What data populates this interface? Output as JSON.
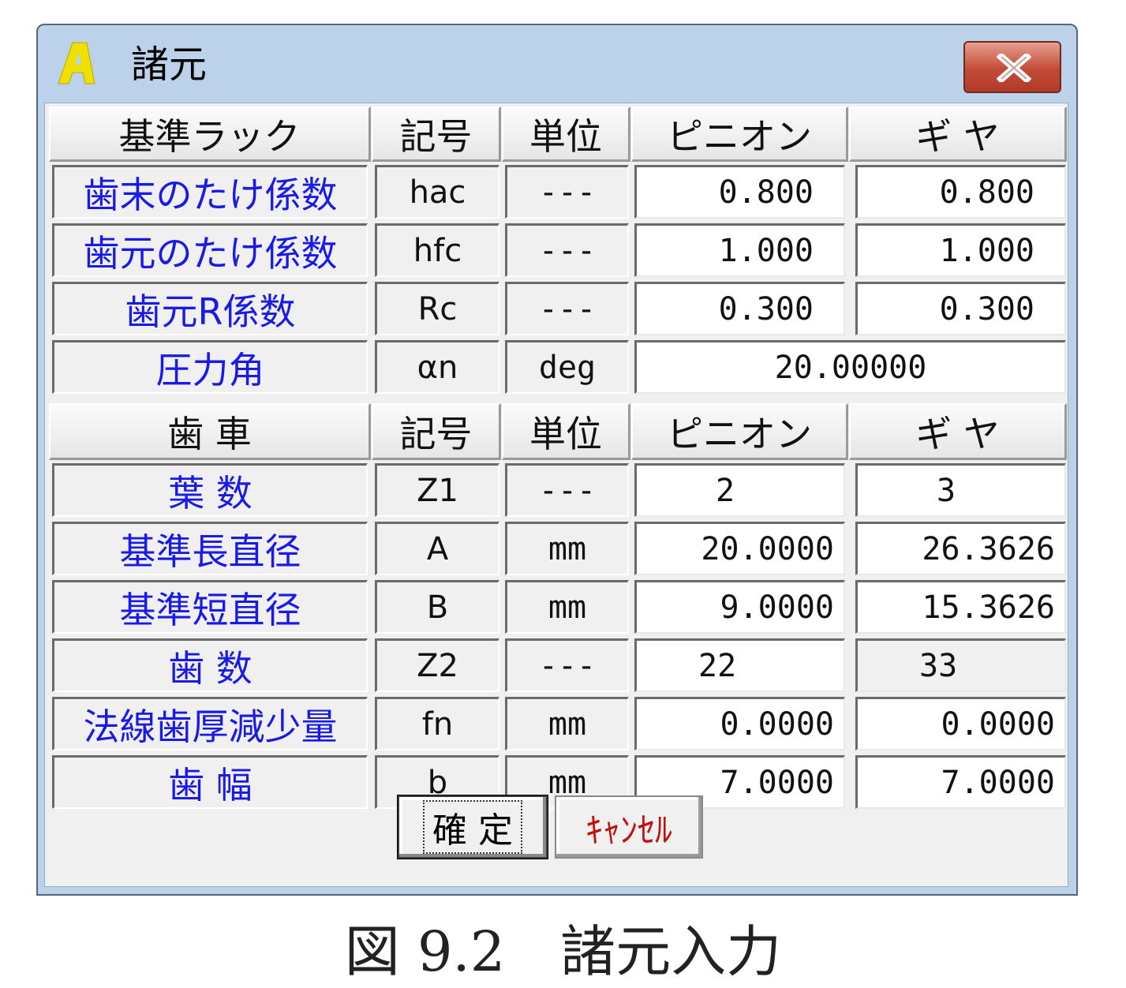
{
  "window": {
    "title": "諸元",
    "app_icon_letter": "A",
    "close_glyph": "close-icon"
  },
  "rack_header": {
    "name": "基準ラック",
    "symbol": "記号",
    "unit": "単位",
    "pinion": "ピニオン",
    "gear": "ギ ヤ"
  },
  "rack_rows": [
    {
      "label": "歯末のたけ係数",
      "symbol": "hac",
      "unit": "---",
      "pinion": "0.800",
      "gear": "0.800"
    },
    {
      "label": "歯元のたけ係数",
      "symbol": "hfc",
      "unit": "---",
      "pinion": "1.000",
      "gear": "1.000"
    },
    {
      "label": "歯元R係数",
      "symbol": "Rc",
      "unit": "---",
      "pinion": "0.300",
      "gear": "0.300"
    },
    {
      "label": "圧力角",
      "symbol": "αn",
      "unit": "deg",
      "shared": "20.00000"
    }
  ],
  "gear_header": {
    "name": "歯 車",
    "symbol": "記号",
    "unit": "単位",
    "pinion": "ピニオン",
    "gear": "ギ ヤ"
  },
  "gear_rows": [
    {
      "label": "葉 数",
      "symbol": "Z1",
      "unit": "---",
      "pinion": "2",
      "gear": "3"
    },
    {
      "label": "基準長直径",
      "symbol": "A",
      "unit": "mm",
      "pinion": "20.0000",
      "gear": "26.3626"
    },
    {
      "label": "基準短直径",
      "symbol": "B",
      "unit": "mm",
      "pinion": "9.0000",
      "gear": "15.3626"
    },
    {
      "label": "歯 数",
      "symbol": "Z2",
      "unit": "---",
      "pinion": "22",
      "gear": "33"
    },
    {
      "label": "法線歯厚減少量",
      "symbol": "fn",
      "unit": "mm",
      "pinion": "0.0000",
      "gear": "0.0000"
    },
    {
      "label": "歯 幅",
      "symbol": "b",
      "unit": "mm",
      "pinion": "7.0000",
      "gear": "7.0000"
    }
  ],
  "buttons": {
    "ok": "確 定",
    "cancel": "ｷｬﾝｾﾙ"
  },
  "caption": "図 9.2　諸元入力",
  "colors": {
    "label_text": "#1a1ae6",
    "cancel_text": "#c01010",
    "titlebar": "#bcd2ea"
  }
}
